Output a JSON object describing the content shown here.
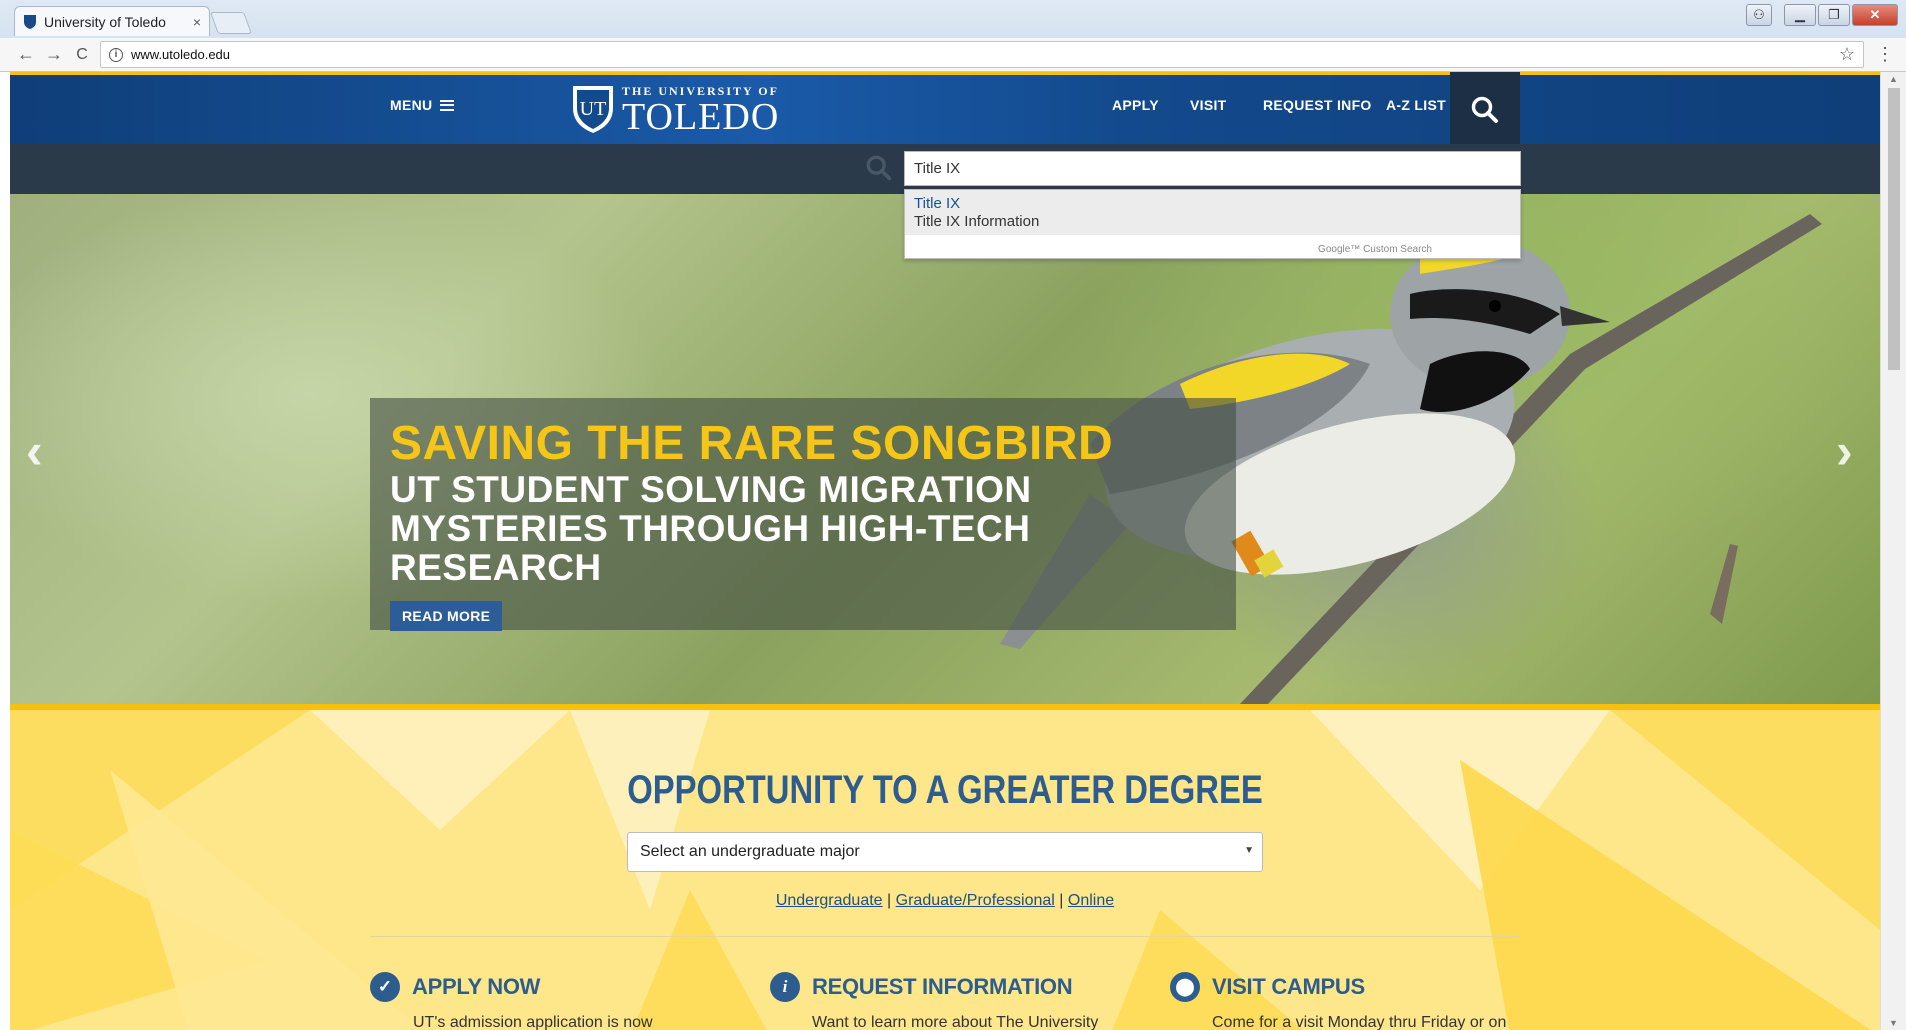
{
  "browser": {
    "tab_title": "University of Toledo",
    "tab_close": "×",
    "url": "www.utoledo.edu",
    "back": "←",
    "forward": "→",
    "reload": "C",
    "star": "☆",
    "menu": "⋮"
  },
  "header": {
    "menu_label": "MENU",
    "logo_small": "THE UNIVERSITY OF",
    "logo_big": "TOLEDO",
    "nav": [
      "APPLY",
      "VISIT",
      "REQUEST INFO",
      "A-Z LIST"
    ]
  },
  "search": {
    "value": "Title IX",
    "suggestions": [
      "Title IX",
      "Title IX Information"
    ],
    "powered_by": "Google™ Custom Search"
  },
  "hero": {
    "headline": "SAVING THE RARE SONGBIRD",
    "sub1": "UT STUDENT SOLVING MIGRATION",
    "sub2": "MYSTERIES THROUGH HIGH-TECH RESEARCH",
    "cta": "READ MORE"
  },
  "degree": {
    "title": "OPPORTUNITY TO A GREATER DEGREE",
    "select_value": "Select an undergraduate major",
    "links": [
      "Undergraduate",
      "Graduate/Professional",
      "Online"
    ],
    "separator": "|"
  },
  "ctas": [
    {
      "label": "APPLY NOW",
      "desc": "UT's admission application is now"
    },
    {
      "label": "REQUEST INFORMATION",
      "desc": "Want to learn more about The University"
    },
    {
      "label": "VISIT CAMPUS",
      "desc": "Come for a visit Monday thru Friday or on"
    }
  ],
  "colors": {
    "brand_blue": "#134a8d",
    "gold": "#f4c20d",
    "heading_blue": "#2d5d8f"
  }
}
